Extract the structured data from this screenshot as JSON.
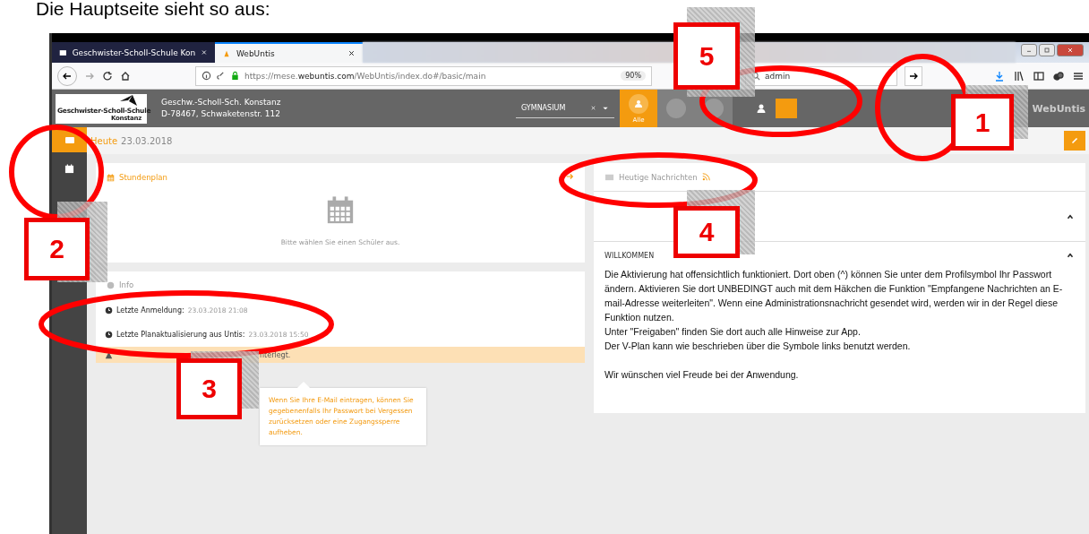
{
  "heading": "Die Hauptseite sieht so aus:",
  "browser": {
    "tabs": [
      {
        "label": "Geschwister-Scholl-Schule Kon",
        "selected": false
      },
      {
        "label": "WebUntis",
        "selected": true
      }
    ],
    "url": "https://mese.**webuntis.com**/WebUntis/index.do#/basic/main",
    "zoom": "90%",
    "search": "admin"
  },
  "header": {
    "logo_lines": [
      "Geschwister-Scholl-Schule",
      "Konstanz"
    ],
    "school_name": "Geschw.-Scholl-Sch. Konstanz",
    "school_address": "D-78467, Schwaketenstr. 112",
    "class_select": "GYMNASIUM",
    "filters": [
      {
        "kind": "group",
        "label": "Alle",
        "selected": true
      },
      {
        "kind": "person",
        "selected": false
      },
      {
        "kind": "person",
        "selected": false
      }
    ],
    "brand": "Web**Untis**"
  },
  "sidebar": [
    {
      "kind": "dashboard",
      "selected": true
    },
    {
      "kind": "calendar",
      "selected": false
    }
  ],
  "today": {
    "label": "Heute",
    "date": "23.03.2018"
  },
  "timetable": {
    "title": "Stundenplan",
    "message": "Bitte wählen Sie einen Schüler aus."
  },
  "info": {
    "title": "Info",
    "rows": [
      {
        "label": "Letzte Anmeldung:",
        "value": "23.03.2018 21:08"
      },
      {
        "label": "Letzte Planaktualisierung aus Untis:",
        "value": "23.03.2018 15:50"
      }
    ],
    "notice": "nterlegt.",
    "tooltip": "Wenn Sie Ihre E-Mail eintragen, können Sie gegebenenfalls Ihr Passwort bei Vergessen zurücksetzen oder eine Zugangssperre aufheben."
  },
  "news": {
    "title": "Heutige Nachrichten",
    "sections": [
      {
        "expanded": true
      },
      {
        "title": "WILLKOMMEN",
        "expanded": true,
        "paragraphs": [
          "Die Aktivierung hat offensichtlich funktioniert. Dort oben (^) können Sie unter dem Profilsymbol Ihr Passwort ändern. Aktivieren Sie dort UNBEDINGT auch mit dem Häkchen die Funktion \"Empfangene Nachrichten an E-mail-Adresse weiterleiten\". Wenn eine Administrationsnachricht gesendet wird, werden wir in der Regel diese Funktion nutzen.",
          "Unter \"Freigaben\" finden Sie dort auch alle Hinweise zur App.",
          "Der V-Plan kann wie beschrieben über die Symbole links benutzt werden.",
          "Wir wünschen viel Freude bei der Anwendung."
        ]
      }
    ]
  },
  "annotations": [
    {
      "number": "5"
    },
    {
      "number": "1"
    },
    {
      "number": "2"
    },
    {
      "number": "3"
    },
    {
      "number": "4"
    }
  ]
}
